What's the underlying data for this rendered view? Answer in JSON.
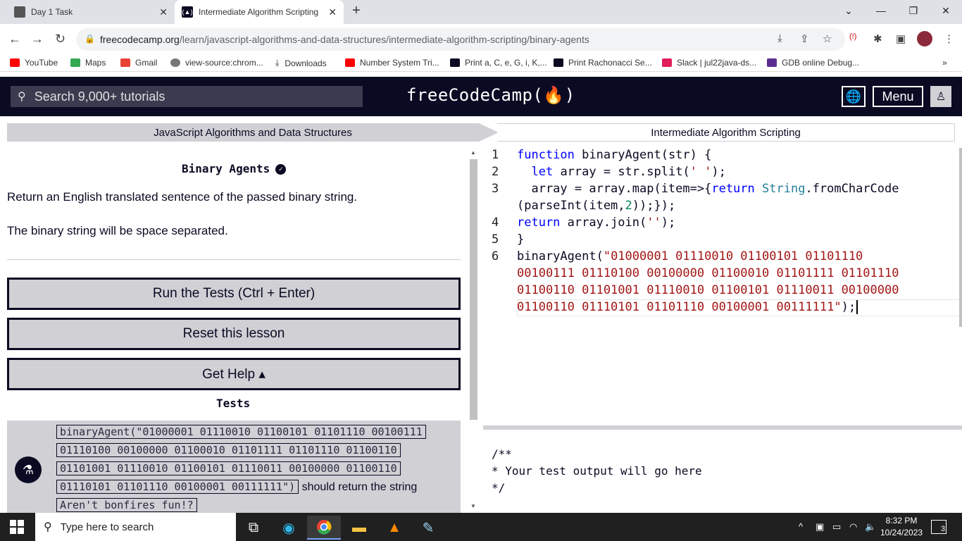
{
  "browser": {
    "tabs": [
      {
        "title": "Day 1 Task"
      },
      {
        "title": "Intermediate Algorithm Scripting"
      }
    ],
    "url_host": "freecodecamp.org",
    "url_path": "/learn/javascript-algorithms-and-data-structures/intermediate-algorithm-scripting/binary-agents",
    "bookmarks": [
      {
        "label": "YouTube",
        "color": "#ff0000"
      },
      {
        "label": "Maps",
        "color": "#34a853"
      },
      {
        "label": "Gmail",
        "color": "#ea4335"
      },
      {
        "label": "view-source:chrom...",
        "color": "#555555"
      },
      {
        "label": "Downloads",
        "color": "#555555"
      },
      {
        "label": "Number System Tri...",
        "color": "#ff0000"
      },
      {
        "label": "Print a, C, e, G, i, K,...",
        "color": "#0a0a23"
      },
      {
        "label": "Print Rachonacci Se...",
        "color": "#0a0a23"
      },
      {
        "label": "Slack | jul22java-ds...",
        "color": "#e01e5a"
      },
      {
        "label": "GDB online Debug...",
        "color": "#5b2d90"
      }
    ]
  },
  "fcc": {
    "search_placeholder": "Search 9,000+ tutorials",
    "logo": "freeCodeCamp(🔥)",
    "menu": "Menu"
  },
  "breadcrumb": {
    "superblock": "JavaScript Algorithms and Data Structures",
    "block": "Intermediate Algorithm Scripting"
  },
  "challenge": {
    "title": "Binary Agents",
    "desc1": "Return an English translated sentence of the passed binary string.",
    "desc2": "The binary string will be space separated.",
    "run_button": "Run the Tests (Ctrl + Enter)",
    "reset_button": "Reset this lesson",
    "help_button": "Get Help ▴",
    "tests_heading": "Tests",
    "test_lines": [
      "binaryAgent(\"01000001 01110010 01100101 01101110 00100111",
      "01110100 00100000 01100010 01101111 01101110 01100110",
      "01101001 01110010 01100101 01110011 00100000 01100110",
      "01110101 01101110 00100001 00111111\")"
    ],
    "test_suffix": "should return the string",
    "test_expected": "Aren't bonfires fun!?"
  },
  "editor": {
    "line_numbers": [
      "1",
      "2",
      "3",
      "4",
      "5",
      "6"
    ],
    "output_lines": [
      "/**",
      "* Your test output will go here",
      "*/"
    ]
  },
  "taskbar": {
    "search_placeholder": "Type here to search",
    "time": "8:32 PM",
    "date": "10/24/2023",
    "notifications": "3"
  }
}
